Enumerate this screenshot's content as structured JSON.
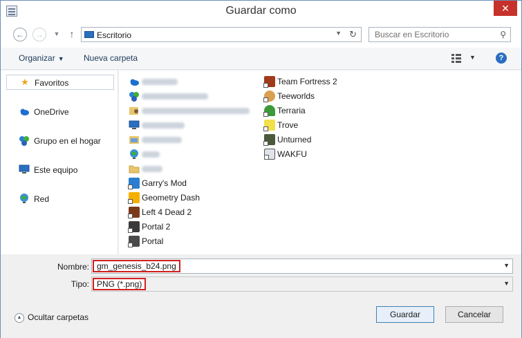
{
  "window": {
    "title": "Guardar como",
    "close_label": "✕"
  },
  "nav": {
    "location": "Escritorio",
    "search_placeholder": "Buscar en Escritorio"
  },
  "toolbar": {
    "organize_label": "Organizar",
    "new_folder_label": "Nueva carpeta",
    "help_label": "?"
  },
  "sidebar": {
    "items": [
      {
        "label": "Favoritos",
        "icon": "star-icon"
      },
      {
        "label": "OneDrive",
        "icon": "cloud-icon"
      },
      {
        "label": "Grupo en el hogar",
        "icon": "homegroup-icon"
      },
      {
        "label": "Este equipo",
        "icon": "computer-icon"
      },
      {
        "label": "Red",
        "icon": "network-icon"
      }
    ]
  },
  "files": {
    "column1": [
      {
        "label": "",
        "icon": "cloud-icon",
        "blurred": true
      },
      {
        "label": "",
        "icon": "homegroup-icon",
        "blurred": true
      },
      {
        "label": "",
        "icon": "user-folder-icon",
        "blurred": true
      },
      {
        "label": "",
        "icon": "computer-icon",
        "blurred": true
      },
      {
        "label": "",
        "icon": "library-icon",
        "blurred": true
      },
      {
        "label": "",
        "icon": "network-icon",
        "blurred": true
      },
      {
        "label": "",
        "icon": "folder-icon",
        "blurred": true
      },
      {
        "label": "Garry's Mod",
        "icon": "garrys-mod-icon"
      },
      {
        "label": "Geometry Dash",
        "icon": "geometry-dash-icon"
      },
      {
        "label": "Left 4 Dead 2",
        "icon": "left4dead2-icon"
      },
      {
        "label": "Portal 2",
        "icon": "portal2-icon"
      },
      {
        "label": "Portal",
        "icon": "portal-icon"
      }
    ],
    "column2": [
      {
        "label": "Team Fortress 2",
        "icon": "team-fortress-2-icon"
      },
      {
        "label": "Teeworlds",
        "icon": "teeworlds-icon"
      },
      {
        "label": "Terraria",
        "icon": "terraria-icon"
      },
      {
        "label": "Trove",
        "icon": "trove-icon"
      },
      {
        "label": "Unturned",
        "icon": "unturned-icon"
      },
      {
        "label": "WAKFU",
        "icon": "wakfu-icon"
      }
    ]
  },
  "form": {
    "name_label": "Nombre:",
    "name_value": "gm_genesis_b24.png",
    "type_label": "Tipo:",
    "type_value": "PNG (*.png)"
  },
  "footer": {
    "hide_folders_label": "Ocultar carpetas",
    "save_label": "Guardar",
    "cancel_label": "Cancelar"
  },
  "colors": {
    "accent": "#2a6fc0",
    "highlight_border": "#d01f1f",
    "close_button": "#c7312b"
  }
}
